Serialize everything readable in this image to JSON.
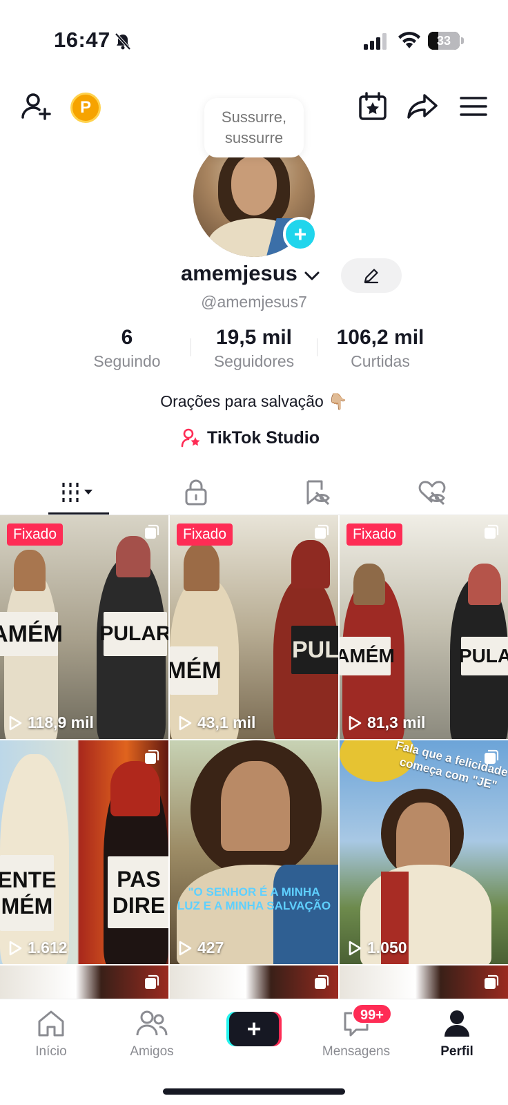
{
  "status_bar": {
    "time": "16:47",
    "battery": "33",
    "battery_level_percent": 33
  },
  "profile": {
    "tooltip": "Sussurre, sussurre",
    "username": "amemjesus",
    "handle": "@amemjesus7",
    "stats": [
      {
        "value": "6",
        "label": "Seguindo"
      },
      {
        "value": "19,5 mil",
        "label": "Seguidores"
      },
      {
        "value": "106,2 mil",
        "label": "Curtidas"
      }
    ],
    "bio": "Orações para salvação 👇🏼",
    "studio_label": "TikTok Studio",
    "coin_letter": "P"
  },
  "tabs": [
    {
      "icon": "grid-icon"
    },
    {
      "icon": "lock-icon"
    },
    {
      "icon": "tag-eye-icon"
    },
    {
      "icon": "heart-eye-icon"
    }
  ],
  "videos": [
    {
      "pinned_label": "Fixado",
      "views": "118,9 mil",
      "sign_left": "AMÉM",
      "sign_right": "PULAR"
    },
    {
      "pinned_label": "Fixado",
      "views": "43,1 mil",
      "sign_left": "MÉM",
      "sign_right": "PUL"
    },
    {
      "pinned_label": "Fixado",
      "views": "81,3 mil",
      "sign_left": "AMÉM",
      "sign_right": "PULA"
    },
    {
      "views": "1.612",
      "sign_left_line1": "ENTE",
      "sign_left_line2": "MÉM",
      "sign_right_line1": "PAS",
      "sign_right_line2": "DIRE"
    },
    {
      "views": "427",
      "caption_line1": "\"O SENHOR É A MINHA",
      "caption_line2": "LUZ E A MINHA SALVAÇÃO"
    },
    {
      "views": "1.050",
      "caption_line1": "Fala que a felicidade",
      "caption_line2": "começa com \"JE\""
    }
  ],
  "bottom_nav": {
    "home": "Início",
    "friends": "Amigos",
    "messages": "Mensagens",
    "messages_badge": "99+",
    "profile": "Perfil"
  },
  "colors": {
    "accent": "#fe2c55",
    "cyan": "#25f4ee",
    "text": "#161823",
    "secondary_text": "#8a8b91"
  }
}
